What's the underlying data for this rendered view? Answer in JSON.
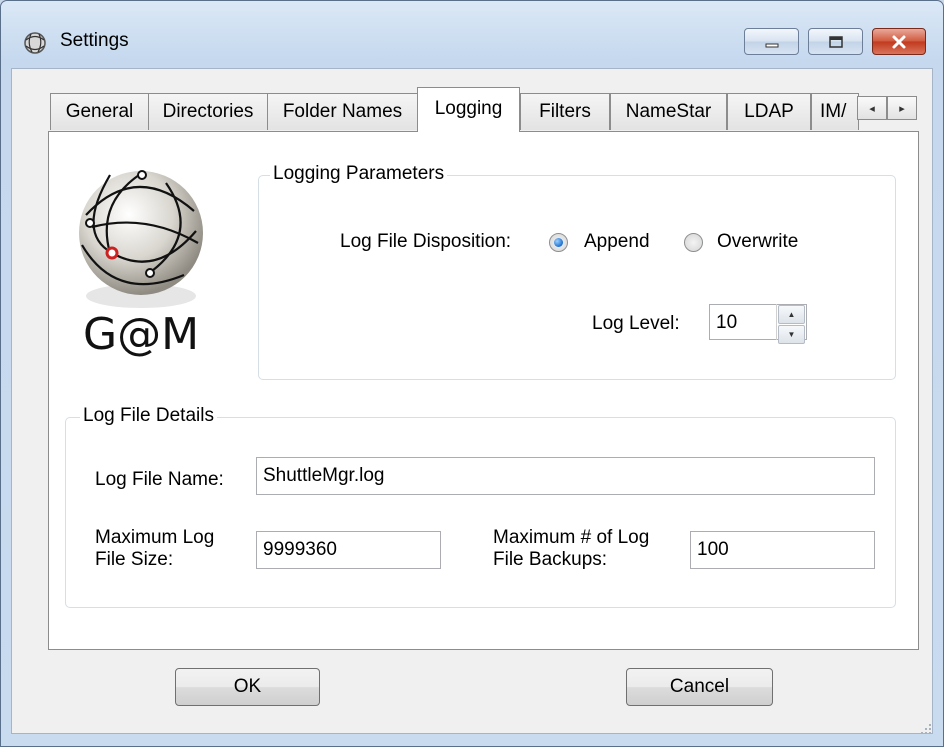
{
  "window": {
    "title": "Settings",
    "controls": {
      "minimize": "minimize",
      "maximize": "maximize",
      "close": "close"
    }
  },
  "tabs": [
    {
      "label": "General",
      "active": false
    },
    {
      "label": "Directories",
      "active": false
    },
    {
      "label": "Folder Names",
      "active": false
    },
    {
      "label": "Logging",
      "active": true
    },
    {
      "label": "Filters",
      "active": false
    },
    {
      "label": "NameStar",
      "active": false
    },
    {
      "label": "LDAP",
      "active": false
    },
    {
      "label": "IM/",
      "active": false
    }
  ],
  "tab_scroll": {
    "left": "◂",
    "right": "▸"
  },
  "logo": {
    "text": "G@M"
  },
  "logging_parameters": {
    "legend": "Logging Parameters",
    "disposition_label": "Log File Disposition:",
    "append_label": "Append",
    "overwrite_label": "Overwrite",
    "selected": "Append",
    "log_level_label": "Log Level:",
    "log_level_value": "10"
  },
  "log_file_details": {
    "legend": "Log File Details",
    "name_label": "Log File Name:",
    "name_value": "ShuttleMgr.log",
    "max_size_label_line1": "Maximum Log",
    "max_size_label_line2": "File Size:",
    "max_size_value": "9999360",
    "max_backups_label_line1": "Maximum # of Log",
    "max_backups_label_line2": "File Backups:",
    "max_backups_value": "100"
  },
  "buttons": {
    "ok": "OK",
    "cancel": "Cancel"
  },
  "colors": {
    "titlebar": "#c5d8ee",
    "close_button": "#c1391d",
    "radio_selected": "#1b6fd0"
  }
}
